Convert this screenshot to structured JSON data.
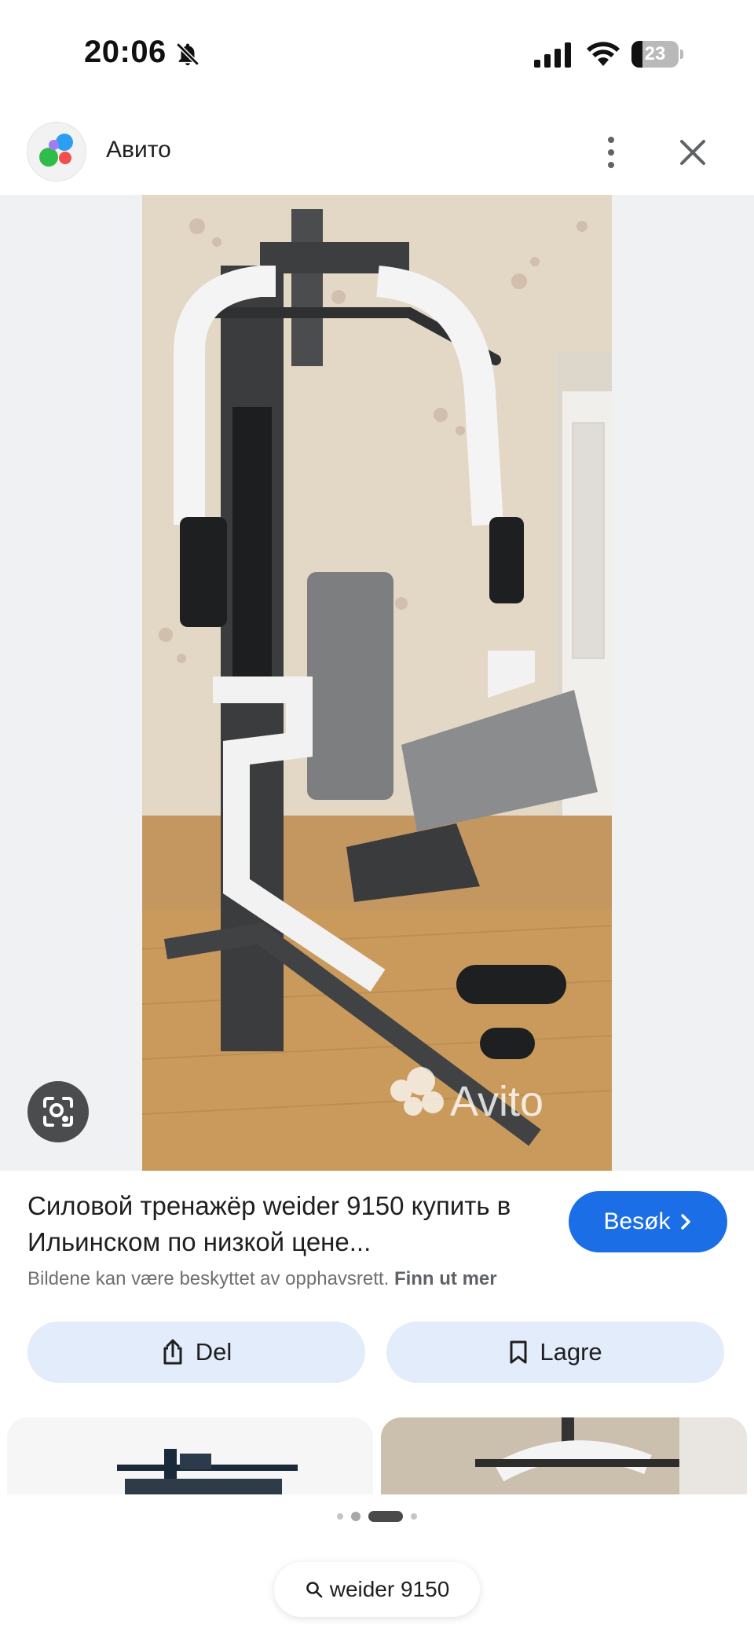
{
  "status_bar": {
    "time": "20:06",
    "battery_level": "23",
    "battery_fraction": 0.23,
    "icons": [
      "bell-slash-icon",
      "cellular-signal-icon",
      "wifi-icon",
      "battery-icon"
    ]
  },
  "header": {
    "site_name": "Авито",
    "logo_colors": [
      "#2fbc4b",
      "#2a9ff2",
      "#a07cf7",
      "#f24e4e"
    ],
    "more_icon": "more-vert-icon",
    "close_icon": "close-icon"
  },
  "image": {
    "watermark": "Avito",
    "lens_icon": "lens-search-icon"
  },
  "result": {
    "title": "Силовой тренажёр weider 9150 купить в Ильинском по низкой цене...",
    "visit_label": "Besøk",
    "copyright_text": "Bildene kan være beskyttet av opphavsrett.",
    "learn_more": "Finn ut mer"
  },
  "actions": {
    "share_label": "Del",
    "save_label": "Lagre"
  },
  "colors": {
    "accent": "#1b6ee6",
    "pill_bg": "#e3ecfa",
    "image_bg": "#eff1f3"
  },
  "bottom": {
    "search_query": "weider 9150"
  }
}
